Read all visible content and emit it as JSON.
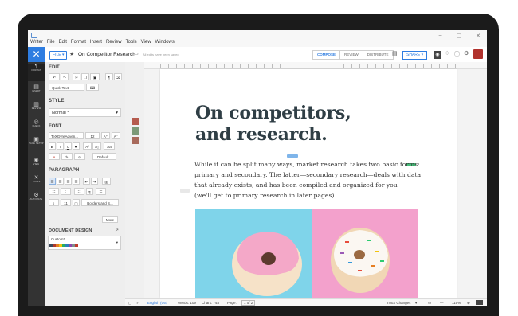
{
  "menubar": {
    "items": [
      "Writer",
      "File",
      "Edit",
      "Format",
      "Insert",
      "Review",
      "Tools",
      "View",
      "Windows"
    ],
    "window_controls": [
      "–",
      "▢",
      "✕"
    ]
  },
  "toolbar": {
    "close_glyph": "✕",
    "file_label": "FILE ▾",
    "doc_title": "On Competitor Research",
    "saved_msg": "All edits have been saved",
    "modes": [
      "COMPOSE",
      "REVIEW",
      "DISTRIBUTE"
    ],
    "active_mode": "COMPOSE",
    "share_label": "SHARE ▾"
  },
  "leftnav": {
    "items": [
      {
        "label": "FORMAT",
        "icon": "format-icon"
      },
      {
        "label": "INSERT",
        "icon": "insert-icon"
      },
      {
        "label": "REVIEW",
        "icon": "review-icon"
      },
      {
        "label": "CHECK",
        "icon": "check-icon"
      },
      {
        "label": "PAGE SETUP",
        "icon": "page-setup-icon"
      },
      {
        "label": "VIEW",
        "icon": "view-icon"
      },
      {
        "label": "TOOLS",
        "icon": "tools-icon"
      },
      {
        "label": "AUTOMATE",
        "icon": "automate-icon"
      }
    ]
  },
  "panel": {
    "edit_label": "EDIT",
    "quick_text": "Quick Text",
    "style_label": "STYLE",
    "style_value": "Normal *",
    "font_label": "FONT",
    "font_family": "TeXGyreAdven...",
    "font_size": "12",
    "default_label": "Default...",
    "paragraph_label": "PARAGRAPH",
    "line_spacing": "11",
    "borders_label": "Borders and S...",
    "more_label": "More",
    "doc_design_label": "DOCUMENT DESIGN",
    "doc_design_value": "Custom*",
    "swatch_colors": [
      "#3d4a5c",
      "#b03a2e",
      "#e67e22",
      "#f1c40f",
      "#27ae60",
      "#2980b9",
      "#8e44ad",
      "#7f8c8d",
      "#c0392b"
    ]
  },
  "document": {
    "heading_lines": [
      "On competitors,",
      "and research."
    ],
    "body_lines": [
      "While it can be split many ways, market research takes two basic forms:",
      "primary and secondary. The latter—secondary research—deals with data",
      "that already exists, and has been compiled and organized for you",
      "(we'll get to primary research in later pages)."
    ]
  },
  "statusbar": {
    "language": "English (US)",
    "words": "Words: 109",
    "chars": "Chars: 748",
    "page_label": "Page:",
    "page_value": "1 of 2",
    "track_changes": "Track Changes",
    "zoom": "115%"
  }
}
